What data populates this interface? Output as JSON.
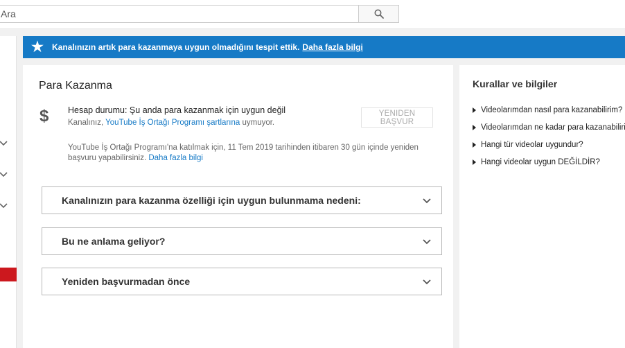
{
  "search": {
    "placeholder": "Ara"
  },
  "banner": {
    "message": "Kanalınızın artık para kazanmaya uygun olmadığını tespit ettik.",
    "link": "Daha fazla bilgi"
  },
  "monetization": {
    "title": "Para Kazanma",
    "status_line": "Hesap durumu: Şu anda para kazanmak için uygun değil",
    "status_sub_prefix": "Kanalınız,",
    "status_sub_link": "YouTube İş Ortağı Programı şartlarına",
    "status_sub_suffix": "uymuyor.",
    "reapply_label": "Yeniden başvur",
    "info_text": "YouTube İş Ortağı Programı'na katılmak için, 11 Tem 2019 tarihinden itibaren 30 gün içinde yeniden başvuru yapabilirsiniz.",
    "info_link": "Daha fazla bilgi"
  },
  "accordions": [
    {
      "label": "Kanalınızın para kazanma özelliği için uygun bulunmama nedeni:"
    },
    {
      "label": "Bu ne anlama geliyor?"
    },
    {
      "label": "Yeniden başvurmadan önce"
    }
  ],
  "sidebar": {
    "title": "Kurallar ve bilgiler",
    "items": [
      {
        "label": "Videolarımdan nasıl para kazanabilirim?"
      },
      {
        "label": "Videolarımdan ne kadar para kazanabilirim?"
      },
      {
        "label": "Hangi tür videolar uygundur?"
      },
      {
        "label": "Hangi videolar uygun DEĞİLDİR?"
      }
    ]
  },
  "colors": {
    "banner_blue": "#167ac6",
    "link_blue": "#167ac6",
    "rail_red": "#cc181e"
  },
  "icons": {
    "search": "search-icon",
    "star": "star-icon",
    "dollar": "dollar-icon",
    "chevron": "chevron-down-icon",
    "triangle": "triangle-right-icon"
  }
}
